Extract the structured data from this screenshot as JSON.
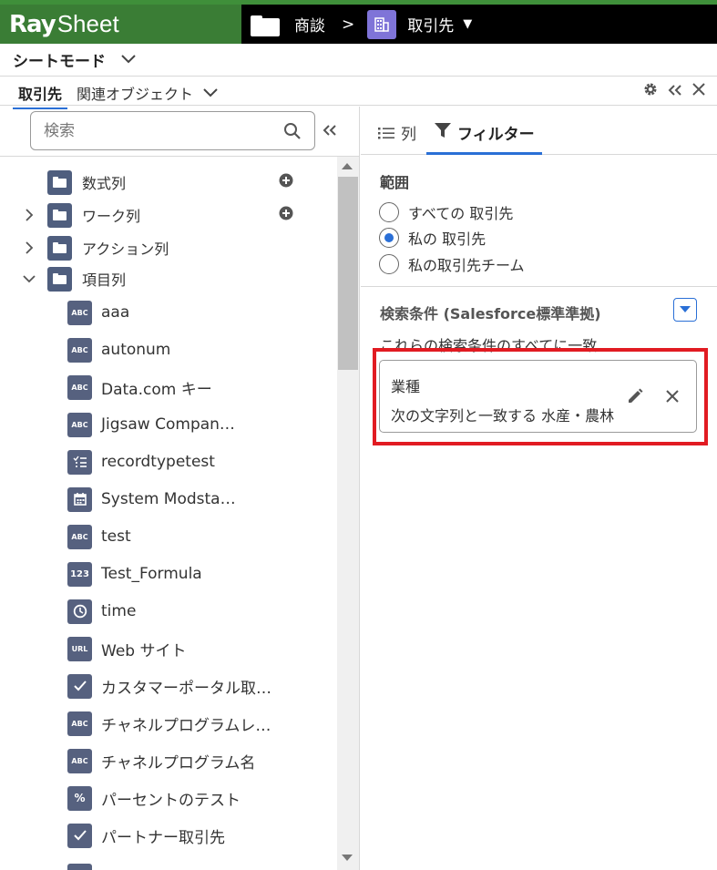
{
  "app": {
    "logo_ray": "Ray",
    "logo_sheet": "Sheet",
    "breadcrumb_parent": "商談",
    "breadcrumb_sep": ">",
    "breadcrumb_current": "取引先",
    "brand_green": "#3a7d35",
    "object_icon_color": "#7f74d8"
  },
  "mode": {
    "label": "シートモード"
  },
  "object_tabs": {
    "main": "取引先",
    "related": "関連オブジェクト"
  },
  "search": {
    "placeholder": "検索"
  },
  "tree": {
    "folders": [
      {
        "label": "数式列",
        "expandable": false,
        "addable": true
      },
      {
        "label": "ワーク列",
        "expandable": true,
        "addable": true
      },
      {
        "label": "アクション列",
        "expandable": true,
        "addable": false
      },
      {
        "label": "項目列",
        "expandable": true,
        "expanded": true,
        "addable": false
      }
    ],
    "fields": [
      {
        "icon": "ABC",
        "icon_name": "text-field-icon",
        "label": "aaa"
      },
      {
        "icon": "ABC",
        "icon_name": "text-field-icon",
        "label": "autonum"
      },
      {
        "icon": "ABC",
        "icon_name": "text-field-icon",
        "label": "Data.com キー"
      },
      {
        "icon": "ABC",
        "icon_name": "text-field-icon",
        "label": "Jigsaw Compan…"
      },
      {
        "icon": "list",
        "icon_name": "picklist-icon",
        "label": "recordtypetest"
      },
      {
        "icon": "cal",
        "icon_name": "calendar-icon",
        "label": "System Modsta…"
      },
      {
        "icon": "ABC",
        "icon_name": "text-field-icon",
        "label": "test"
      },
      {
        "icon": "123",
        "icon_name": "number-field-icon",
        "label": "Test_Formula"
      },
      {
        "icon": "clock",
        "icon_name": "clock-icon",
        "label": "time"
      },
      {
        "icon": "URL",
        "icon_name": "url-field-icon",
        "label": "Web サイト"
      },
      {
        "icon": "check",
        "icon_name": "checkbox-field-icon",
        "label": "カスタマーポータル取…"
      },
      {
        "icon": "ABC",
        "icon_name": "text-field-icon",
        "label": "チャネルプログラムレ…"
      },
      {
        "icon": "ABC",
        "icon_name": "text-field-icon",
        "label": "チャネルプログラム名"
      },
      {
        "icon": "%",
        "icon_name": "percent-field-icon",
        "label": "パーセントのテスト"
      },
      {
        "icon": "check",
        "icon_name": "checkbox-field-icon",
        "label": "パートナー取引先"
      }
    ]
  },
  "right_tabs": {
    "columns": "列",
    "filter": "フィルター",
    "active": "filter"
  },
  "scope": {
    "title": "範囲",
    "options": [
      {
        "label": "すべての 取引先",
        "checked": false
      },
      {
        "label": "私の 取引先",
        "checked": true
      },
      {
        "label": "私の取引先チーム",
        "checked": false
      }
    ]
  },
  "conditions": {
    "title": "検索条件 (Salesforce標準準拠)",
    "subtitle": "これらの検索条件のすべてに一致",
    "items": [
      {
        "field": "業種",
        "expression": "次の文字列と一致する 水産・農林"
      }
    ]
  },
  "colors": {
    "accent": "#2a6fd6",
    "highlight": "#e11b22",
    "field_icon": "#56617f"
  }
}
